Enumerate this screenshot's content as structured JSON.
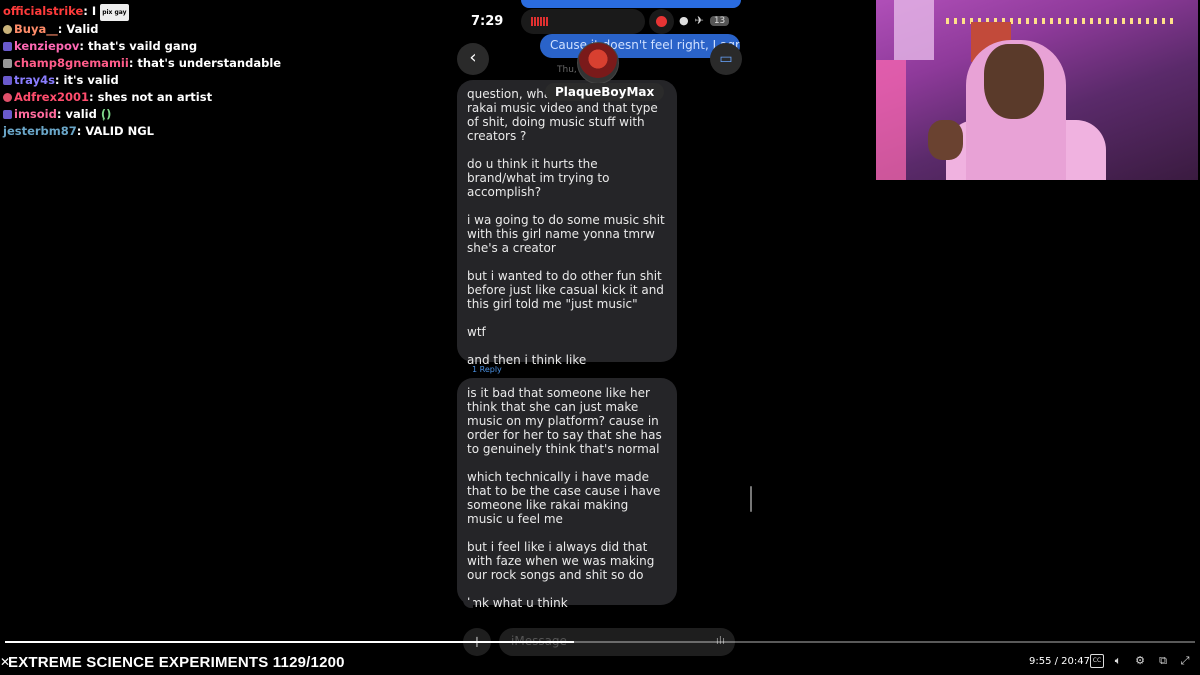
{
  "chat": [
    {
      "user": "officialstrike",
      "color": "#ff3b3b",
      "badge": "none",
      "message": "I",
      "emote": "pix gay"
    },
    {
      "user": "Buya__",
      "color": "#ff8c69",
      "badge": "ninja",
      "message": "Valid"
    },
    {
      "user": "kenziepov",
      "color": "#ff69b4",
      "badge": "sub",
      "message": "that's vaild gang"
    },
    {
      "user": "champ8gnemamii",
      "color": "#ff5c8a",
      "badge": "gray",
      "message": "that's understandable"
    },
    {
      "user": "tray4s",
      "color": "#8a7dff",
      "badge": "sub",
      "message": "it's valid"
    },
    {
      "user": "Adfrex2001",
      "color": "#ff4d6d",
      "badge": "heart",
      "message": "shes not an artist"
    },
    {
      "user": "imsoid",
      "color": "#ff6b9d",
      "badge": "sub",
      "message": "valid",
      "emote2": "(ͅ)"
    },
    {
      "user": "jesterbm87",
      "color": "#6aa6c8",
      "badge": "none",
      "message": "VALID NGL"
    }
  ],
  "phone": {
    "time": "7:29",
    "status_badge": "13",
    "sent_preview": "Cause it doesn't feel right, I agr",
    "date_label": "Thu,",
    "contact_name": "PlaqueBoyMax",
    "message1": [
      "question, what do u think of the rakai music video and that type of shit, doing music stuff with creators ?",
      "do u think it hurts the brand/what im trying to accomplish?",
      "i wa going to do some music shit with this girl name yonna tmrw she's a creator",
      "but i wanted to do other fun shit before just like casual kick it and this girl told me \"just music\"",
      "wtf",
      "and then i think like"
    ],
    "reply_link": "1 Reply",
    "message2": [
      "is it bad that someone like her think that she can just make music on my platform? cause in order for her to say that she has to genuinely think that's normal",
      "which technically i have made that to be the case cause i have someone like rakai making music u feel me",
      "but i feel like i always did that with faze when we was making our rock songs and shit so do",
      "lmk what u think"
    ],
    "input_placeholder": "iMessage"
  },
  "player": {
    "title": "EXTREME SCIENCE EXPERIMENTS 1129/1200",
    "time": "9:55 / 20:47",
    "progress": 0.478,
    "icons": [
      "cc-icon",
      "volume-icon",
      "settings-icon",
      "theater-icon",
      "fullscreen-icon"
    ]
  }
}
